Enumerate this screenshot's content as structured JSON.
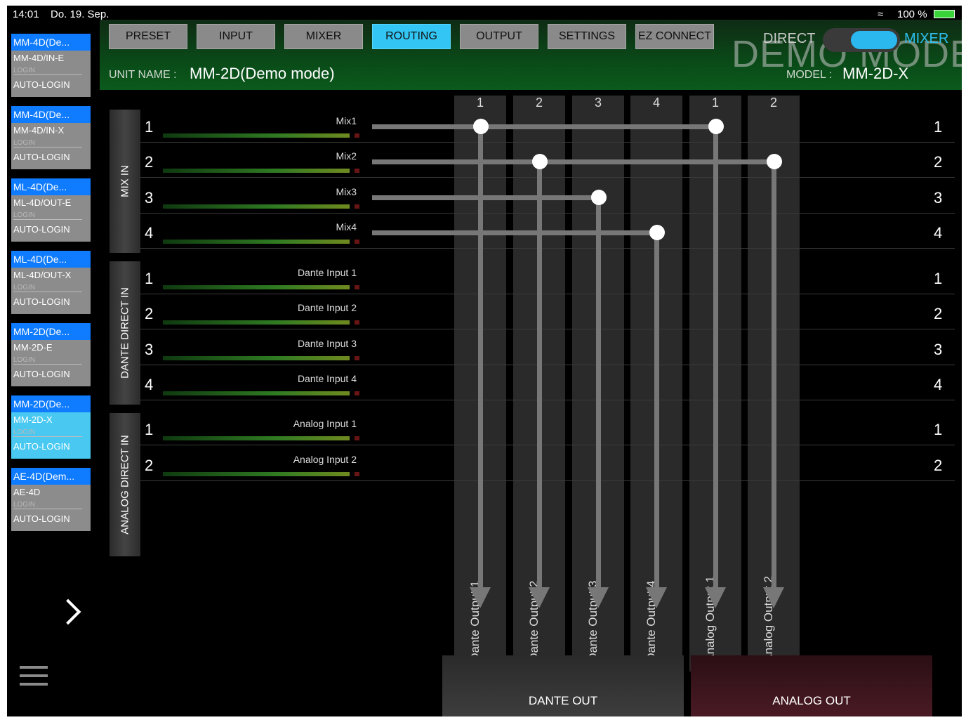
{
  "status": {
    "time": "14:01",
    "date": "Do. 19. Sep.",
    "battery": "100 %"
  },
  "devices": [
    {
      "title": "MM-4D(De...",
      "model": "MM-4D/IN-E",
      "login": "LOGIN",
      "auto": "AUTO-LOGIN"
    },
    {
      "title": "MM-4D(De...",
      "model": "MM-4D/IN-X",
      "login": "LOGIN",
      "auto": "AUTO-LOGIN"
    },
    {
      "title": "ML-4D(De...",
      "model": "ML-4D/OUT-E",
      "login": "LOGIN",
      "auto": "AUTO-LOGIN"
    },
    {
      "title": "ML-4D(De...",
      "model": "ML-4D/OUT-X",
      "login": "LOGIN",
      "auto": "AUTO-LOGIN"
    },
    {
      "title": "MM-2D(De...",
      "model": "MM-2D-E",
      "login": "LOGIN",
      "auto": "AUTO-LOGIN"
    },
    {
      "title": "MM-2D(De...",
      "model": "MM-2D-X",
      "login": "LOGIN",
      "auto": "AUTO-LOGIN"
    },
    {
      "title": "AE-4D(Dem...",
      "model": "AE-4D",
      "login": "LOGIN",
      "auto": "AUTO-LOGIN"
    }
  ],
  "tabs": [
    "PRESET",
    "INPUT",
    "MIXER",
    "ROUTING",
    "OUTPUT",
    "SETTINGS",
    "EZ CONNECT"
  ],
  "active_tab": "ROUTING",
  "header": {
    "unit_label": "UNIT NAME :",
    "unit_name": "MM-2D(Demo mode)",
    "model_label": "MODEL :",
    "model": "MM-2D-X",
    "demo_mode": "DEMO MODE",
    "direct": "DIRECT",
    "mixer": "MIXER"
  },
  "groups": {
    "mix_in": "MIX IN",
    "dante_direct_in": "DANTE DIRECT IN",
    "analog_direct_in": "ANALOG DIRECT IN"
  },
  "inputs": [
    {
      "num": "1",
      "name": "Mix1"
    },
    {
      "num": "2",
      "name": "Mix2"
    },
    {
      "num": "3",
      "name": "Mix3"
    },
    {
      "num": "4",
      "name": "Mix4"
    },
    {
      "num": "1",
      "name": "Dante Input 1"
    },
    {
      "num": "2",
      "name": "Dante Input 2"
    },
    {
      "num": "3",
      "name": "Dante Input 3"
    },
    {
      "num": "4",
      "name": "Dante Input 4"
    },
    {
      "num": "1",
      "name": "Analog Input 1"
    },
    {
      "num": "2",
      "name": "Analog Input 2"
    }
  ],
  "outputs": [
    {
      "num": "1",
      "name": "Dante Output 1"
    },
    {
      "num": "2",
      "name": "Dante Output 2"
    },
    {
      "num": "3",
      "name": "Dante Output 3"
    },
    {
      "num": "4",
      "name": "Dante Output 4"
    },
    {
      "num": "1",
      "name": "Analog Output 1"
    },
    {
      "num": "2",
      "name": "Analog Output 2"
    }
  ],
  "routes": [
    [
      0,
      0
    ],
    [
      0,
      4
    ],
    [
      1,
      1
    ],
    [
      1,
      5
    ],
    [
      2,
      2
    ],
    [
      3,
      3
    ]
  ],
  "out_groups": {
    "dante": "DANTE OUT",
    "analog": "ANALOG OUT"
  },
  "colors": {
    "accent": "#33c6f4",
    "header_green": "#0b5a1c",
    "analog_out": "#4a1a24"
  }
}
